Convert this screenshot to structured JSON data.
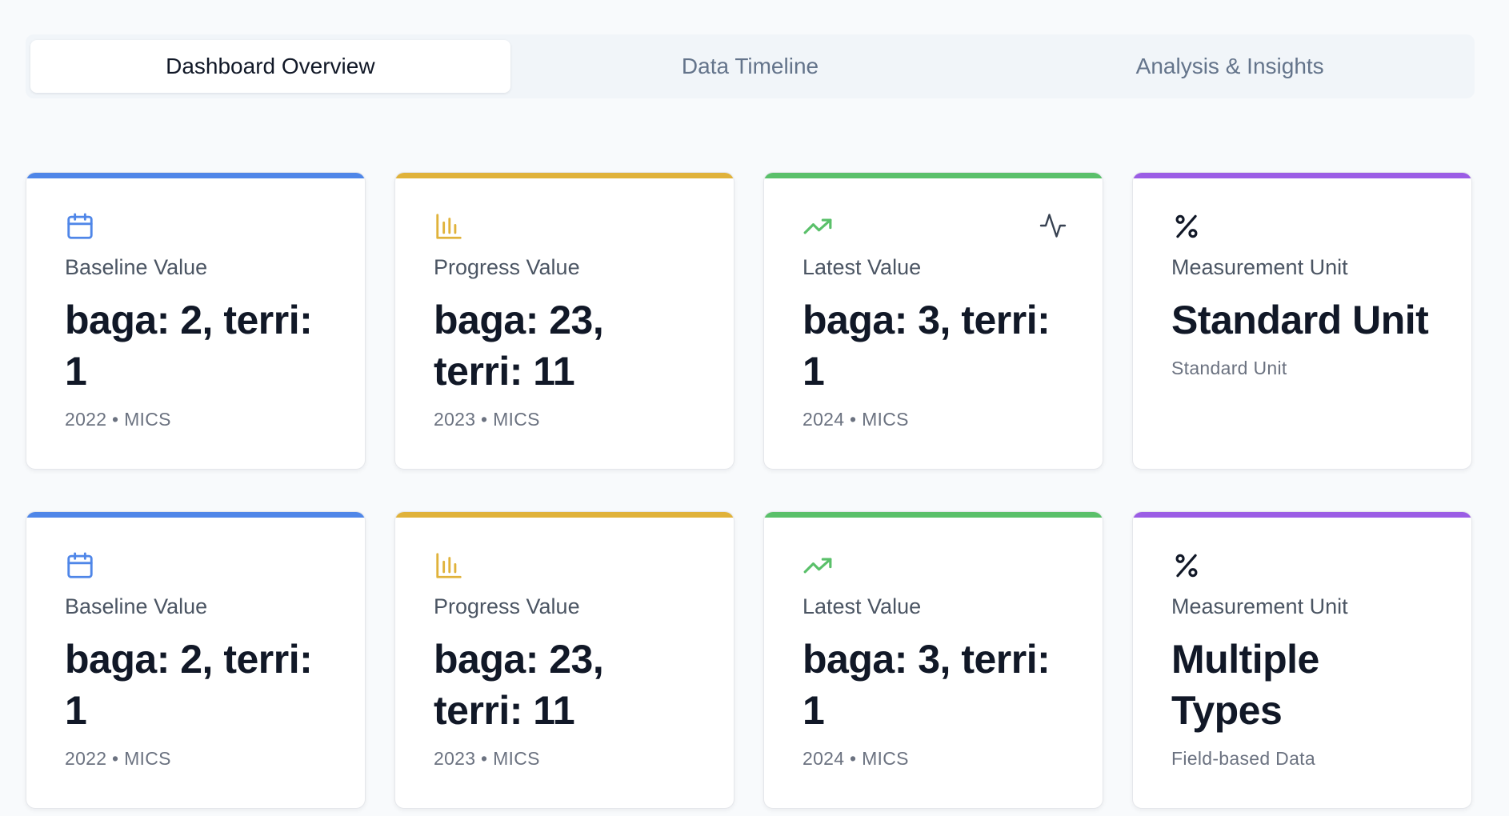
{
  "colors": {
    "blue": "#4f86e8",
    "yellow": "#e0b23a",
    "green": "#5ac06a",
    "purple": "#9b5de5"
  },
  "tabs": [
    {
      "label": "Dashboard Overview",
      "active": true
    },
    {
      "label": "Data Timeline",
      "active": false
    },
    {
      "label": "Analysis & Insights",
      "active": false
    }
  ],
  "cards": [
    {
      "icon": "calendar-icon",
      "label": "Baseline Value",
      "value": "baga: 2, terri: 1",
      "meta": "2022 • MICS"
    },
    {
      "icon": "bar-chart-icon",
      "label": "Progress Value",
      "value": "baga: 23, terri: 11",
      "meta": "2023 • MICS"
    },
    {
      "icon": "trending-up-icon",
      "side_icon": "activity-icon",
      "label": "Latest Value",
      "value": "baga: 3, terri: 1",
      "meta": "2024 • MICS"
    },
    {
      "icon": "percent-icon",
      "label": "Measurement Unit",
      "value": "Standard Unit",
      "meta": "Standard Unit"
    },
    {
      "icon": "calendar-icon",
      "label": "Baseline Value",
      "value": "baga: 2, terri: 1",
      "meta": "2022 • MICS"
    },
    {
      "icon": "bar-chart-icon",
      "label": "Progress Value",
      "value": "baga: 23, terri: 11",
      "meta": "2023 • MICS"
    },
    {
      "icon": "trending-up-icon",
      "label": "Latest Value",
      "value": "baga: 3, terri: 1",
      "meta": "2024 • MICS"
    },
    {
      "icon": "percent-icon",
      "label": "Measurement Unit",
      "value": "Multiple Types",
      "meta": "Field-based Data"
    }
  ]
}
